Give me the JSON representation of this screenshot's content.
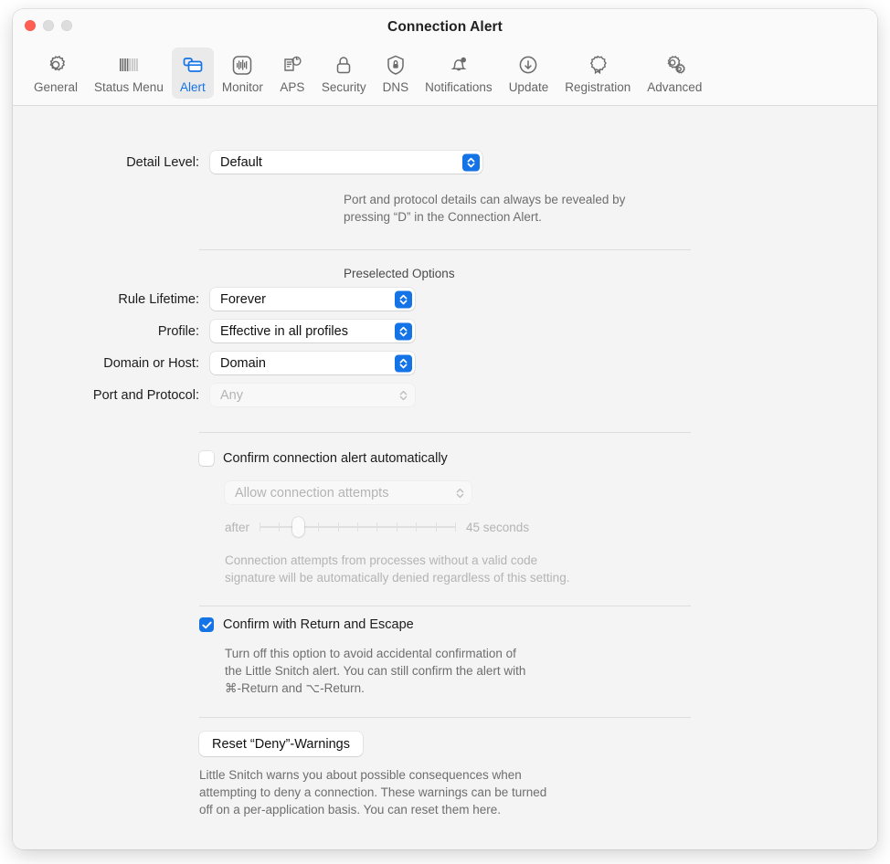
{
  "window": {
    "title": "Connection Alert",
    "traffic_lights": [
      "close",
      "minimize",
      "zoom"
    ]
  },
  "toolbar": {
    "selected": "Alert",
    "items": [
      {
        "label": "General",
        "icon": "gear-icon"
      },
      {
        "label": "Status Menu",
        "icon": "barcode-icon"
      },
      {
        "label": "Alert",
        "icon": "alert-windows-icon"
      },
      {
        "label": "Monitor",
        "icon": "waveform-icon"
      },
      {
        "label": "APS",
        "icon": "document-refresh-icon"
      },
      {
        "label": "Security",
        "icon": "lock-icon"
      },
      {
        "label": "DNS",
        "icon": "shield-lock-icon"
      },
      {
        "label": "Notifications",
        "icon": "bell-badge-icon"
      },
      {
        "label": "Update",
        "icon": "download-circle-icon"
      },
      {
        "label": "Registration",
        "icon": "rosette-icon"
      },
      {
        "label": "Advanced",
        "icon": "gears-icon"
      }
    ]
  },
  "detail_level": {
    "label": "Detail Level:",
    "value": "Default",
    "help_line1": "Port and protocol details can always be revealed by",
    "help_line2": "pressing “D” in the Connection Alert."
  },
  "preselected": {
    "section_title": "Preselected Options",
    "rows": [
      {
        "label": "Rule Lifetime:",
        "value": "Forever",
        "enabled": true
      },
      {
        "label": "Profile:",
        "value": "Effective in all profiles",
        "enabled": true
      },
      {
        "label": "Domain or Host:",
        "value": "Domain",
        "enabled": true
      },
      {
        "label": "Port and Protocol:",
        "value": "Any",
        "enabled": false
      }
    ]
  },
  "auto_confirm": {
    "checkbox_label": "Confirm connection alert automatically",
    "checked": false,
    "action_value": "Allow connection attempts",
    "after_label": "after",
    "duration_label": "45 seconds",
    "slider_ticks": 11,
    "slider_position_percent": 18,
    "help_line1": "Connection attempts from processes without a valid code",
    "help_line2": "signature will be automatically denied regardless of this setting."
  },
  "return_escape": {
    "checkbox_label": "Confirm with Return and Escape",
    "checked": true,
    "help_line1": "Turn off this option to avoid accidental confirmation of",
    "help_line2": "the Little Snitch alert. You can still confirm the alert with",
    "help_line3": "⌘-Return and ⌥-Return."
  },
  "reset_warnings": {
    "button_label": "Reset “Deny”-Warnings",
    "help_line1": "Little Snitch warns you about possible consequences when",
    "help_line2": "attempting to deny a connection. These warnings can be turned",
    "help_line3": "off on a per-application basis. You can reset them here."
  },
  "colors": {
    "accent": "#1473e6",
    "close_button": "#ff5f52",
    "window_background": "#f4f4f4",
    "toolbar_background": "#fafafa"
  }
}
